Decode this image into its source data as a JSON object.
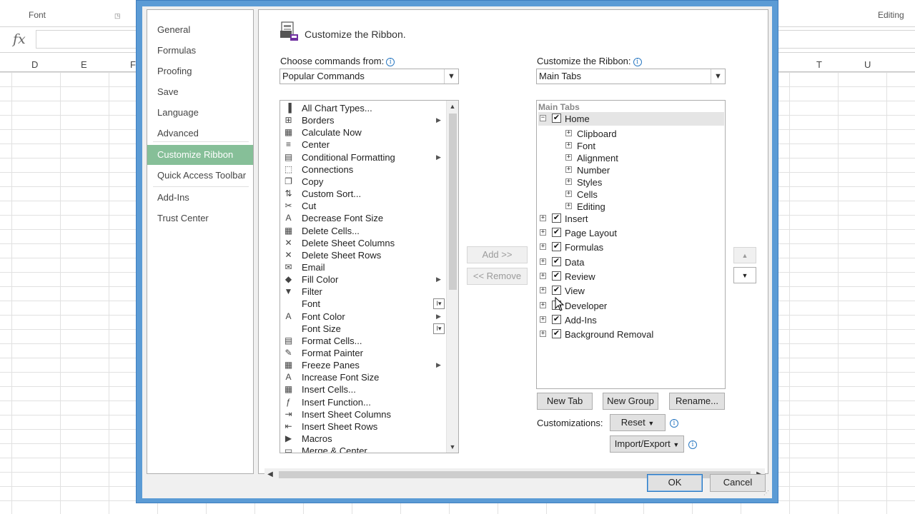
{
  "excel": {
    "ribbon_groups": {
      "font": "Font",
      "editing": "Editing"
    },
    "fx": "fx",
    "columns_left": [
      "D",
      "E",
      "F"
    ],
    "columns_right": [
      "T",
      "U"
    ]
  },
  "dialog": {
    "nav_items": [
      {
        "label": "General",
        "selected": false
      },
      {
        "label": "Formulas",
        "selected": false
      },
      {
        "label": "Proofing",
        "selected": false
      },
      {
        "label": "Save",
        "selected": false
      },
      {
        "label": "Language",
        "selected": false
      },
      {
        "label": "Advanced",
        "selected": false
      },
      {
        "label": "Customize Ribbon",
        "selected": true
      },
      {
        "label": "Quick Access Toolbar",
        "selected": false
      },
      {
        "label": "Add-Ins",
        "selected": false
      },
      {
        "label": "Trust Center",
        "selected": false
      }
    ],
    "page_title": "Customize the Ribbon.",
    "choose_label": "Choose commands from:",
    "choose_value": "Popular Commands",
    "customize_label": "Customize the Ribbon:",
    "customize_value": "Main Tabs",
    "commands": [
      {
        "label": "All Chart Types...",
        "icon": "chart-icon",
        "glyph": "▐",
        "extra": ""
      },
      {
        "label": "Borders",
        "icon": "borders-icon",
        "glyph": "⊞",
        "extra": "submenu"
      },
      {
        "label": "Calculate Now",
        "icon": "calculator-icon",
        "glyph": "▦",
        "extra": ""
      },
      {
        "label": "Center",
        "icon": "align-center-icon",
        "glyph": "≡",
        "extra": ""
      },
      {
        "label": "Conditional Formatting",
        "icon": "conditional-format-icon",
        "glyph": "▤",
        "extra": "submenu"
      },
      {
        "label": "Connections",
        "icon": "connections-icon",
        "glyph": "⬚",
        "extra": ""
      },
      {
        "label": "Copy",
        "icon": "copy-icon",
        "glyph": "❐",
        "extra": ""
      },
      {
        "label": "Custom Sort...",
        "icon": "sort-icon",
        "glyph": "⇅",
        "extra": ""
      },
      {
        "label": "Cut",
        "icon": "scissors-icon",
        "glyph": "✂",
        "extra": ""
      },
      {
        "label": "Decrease Font Size",
        "icon": "decrease-font-icon",
        "glyph": "A",
        "extra": ""
      },
      {
        "label": "Delete Cells...",
        "icon": "delete-cells-icon",
        "glyph": "▦",
        "extra": ""
      },
      {
        "label": "Delete Sheet Columns",
        "icon": "delete-columns-icon",
        "glyph": "✕",
        "extra": ""
      },
      {
        "label": "Delete Sheet Rows",
        "icon": "delete-rows-icon",
        "glyph": "✕",
        "extra": ""
      },
      {
        "label": "Email",
        "icon": "email-icon",
        "glyph": "✉",
        "extra": ""
      },
      {
        "label": "Fill Color",
        "icon": "fill-color-icon",
        "glyph": "◆",
        "extra": "submenu"
      },
      {
        "label": "Filter",
        "icon": "filter-icon",
        "glyph": "▼",
        "extra": ""
      },
      {
        "label": "Font",
        "icon": "font-icon",
        "glyph": "",
        "extra": "control"
      },
      {
        "label": "Font Color",
        "icon": "font-color-icon",
        "glyph": "A",
        "extra": "submenu"
      },
      {
        "label": "Font Size",
        "icon": "font-size-icon",
        "glyph": "",
        "extra": "control"
      },
      {
        "label": "Format Cells...",
        "icon": "format-cells-icon",
        "glyph": "▤",
        "extra": ""
      },
      {
        "label": "Format Painter",
        "icon": "format-painter-icon",
        "glyph": "✎",
        "extra": ""
      },
      {
        "label": "Freeze Panes",
        "icon": "freeze-panes-icon",
        "glyph": "▦",
        "extra": "submenu"
      },
      {
        "label": "Increase Font Size",
        "icon": "increase-font-icon",
        "glyph": "A",
        "extra": ""
      },
      {
        "label": "Insert Cells...",
        "icon": "insert-cells-icon",
        "glyph": "▦",
        "extra": ""
      },
      {
        "label": "Insert Function...",
        "icon": "insert-function-icon",
        "glyph": "ƒ",
        "extra": ""
      },
      {
        "label": "Insert Sheet Columns",
        "icon": "insert-columns-icon",
        "glyph": "⇥",
        "extra": ""
      },
      {
        "label": "Insert Sheet Rows",
        "icon": "insert-rows-icon",
        "glyph": "⇤",
        "extra": ""
      },
      {
        "label": "Macros",
        "icon": "macros-icon",
        "glyph": "▶",
        "extra": ""
      },
      {
        "label": "Merge & Center",
        "icon": "merge-center-icon",
        "glyph": "▭",
        "extra": ""
      }
    ],
    "tree_header": "Main Tabs",
    "tree": [
      {
        "label": "Home",
        "level": 0,
        "expander": "−",
        "checked": true,
        "has_check": true,
        "highlight": true
      },
      {
        "label": "Clipboard",
        "level": 1,
        "expander": "+",
        "has_check": false
      },
      {
        "label": "Font",
        "level": 1,
        "expander": "+",
        "has_check": false
      },
      {
        "label": "Alignment",
        "level": 1,
        "expander": "+",
        "has_check": false
      },
      {
        "label": "Number",
        "level": 1,
        "expander": "+",
        "has_check": false
      },
      {
        "label": "Styles",
        "level": 1,
        "expander": "+",
        "has_check": false
      },
      {
        "label": "Cells",
        "level": 1,
        "expander": "+",
        "has_check": false
      },
      {
        "label": "Editing",
        "level": 1,
        "expander": "+",
        "has_check": false
      },
      {
        "label": "Insert",
        "level": 0,
        "expander": "+",
        "checked": true,
        "has_check": true
      },
      {
        "label": "Page Layout",
        "level": 0,
        "expander": "+",
        "checked": true,
        "has_check": true
      },
      {
        "label": "Formulas",
        "level": 0,
        "expander": "+",
        "checked": true,
        "has_check": true
      },
      {
        "label": "Data",
        "level": 0,
        "expander": "+",
        "checked": true,
        "has_check": true
      },
      {
        "label": "Review",
        "level": 0,
        "expander": "+",
        "checked": true,
        "has_check": true
      },
      {
        "label": "View",
        "level": 0,
        "expander": "+",
        "checked": true,
        "has_check": true
      },
      {
        "label": "Developer",
        "level": 0,
        "expander": "+",
        "checked": false,
        "has_check": true
      },
      {
        "label": "Add-Ins",
        "level": 0,
        "expander": "+",
        "checked": true,
        "has_check": true
      },
      {
        "label": "Background Removal",
        "level": 0,
        "expander": "+",
        "checked": true,
        "has_check": true
      }
    ],
    "add_button": "Add >>",
    "remove_button": "<< Remove",
    "new_tab_button": "New Tab",
    "new_group_button": "New Group",
    "rename_button": "Rename...",
    "customizations_label": "Customizations:",
    "reset_button": "Reset",
    "import_export_button": "Import/Export",
    "ok_button": "OK",
    "cancel_button": "Cancel",
    "colors": {
      "accent": "#5b9bd5",
      "selected_nav": "#86bf98"
    }
  }
}
